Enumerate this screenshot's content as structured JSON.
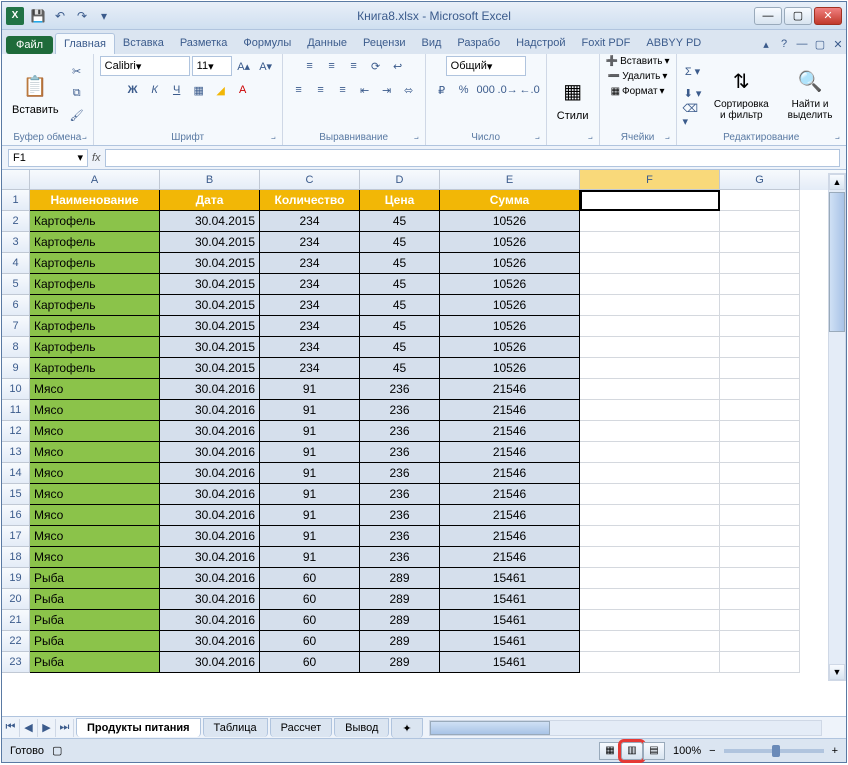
{
  "window": {
    "title": "Книга8.xlsx - Microsoft Excel",
    "app_letter": "X"
  },
  "qat": {
    "save": "💾",
    "undo": "↶",
    "redo": "↷"
  },
  "tabs": {
    "file": "Файл",
    "items": [
      "Главная",
      "Вставка",
      "Разметка",
      "Формулы",
      "Данные",
      "Рецензи",
      "Вид",
      "Разрабо",
      "Надстрой",
      "Foxit PDF",
      "ABBYY PD"
    ],
    "active_index": 0
  },
  "ribbon": {
    "clipboard": {
      "paste": "Вставить",
      "label": "Буфер обмена"
    },
    "font": {
      "name": "Calibri",
      "size": "11",
      "label": "Шрифт",
      "bold": "Ж",
      "italic": "К",
      "underline": "Ч"
    },
    "alignment": {
      "label": "Выравнивание"
    },
    "number": {
      "format": "Общий",
      "label": "Число"
    },
    "styles": {
      "btn": "Стили",
      "label": ""
    },
    "cells": {
      "insert": "Вставить",
      "delete": "Удалить",
      "format": "Формат",
      "label": "Ячейки"
    },
    "editing": {
      "sort": "Сортировка и фильтр",
      "find": "Найти и выделить",
      "label": "Редактирование"
    }
  },
  "formula_bar": {
    "name_box": "F1",
    "fx": "fx",
    "value": ""
  },
  "columns": [
    "A",
    "B",
    "C",
    "D",
    "E",
    "F",
    "G"
  ],
  "selected_cell": "F1",
  "headers": [
    "Наименование",
    "Дата",
    "Количество",
    "Цена",
    "Сумма"
  ],
  "rows": [
    {
      "n": "Картофель",
      "d": "30.04.2015",
      "q": "234",
      "p": "45",
      "s": "10526"
    },
    {
      "n": "Картофель",
      "d": "30.04.2015",
      "q": "234",
      "p": "45",
      "s": "10526"
    },
    {
      "n": "Картофель",
      "d": "30.04.2015",
      "q": "234",
      "p": "45",
      "s": "10526"
    },
    {
      "n": "Картофель",
      "d": "30.04.2015",
      "q": "234",
      "p": "45",
      "s": "10526"
    },
    {
      "n": "Картофель",
      "d": "30.04.2015",
      "q": "234",
      "p": "45",
      "s": "10526"
    },
    {
      "n": "Картофель",
      "d": "30.04.2015",
      "q": "234",
      "p": "45",
      "s": "10526"
    },
    {
      "n": "Картофель",
      "d": "30.04.2015",
      "q": "234",
      "p": "45",
      "s": "10526"
    },
    {
      "n": "Картофель",
      "d": "30.04.2015",
      "q": "234",
      "p": "45",
      "s": "10526"
    },
    {
      "n": "Мясо",
      "d": "30.04.2016",
      "q": "91",
      "p": "236",
      "s": "21546"
    },
    {
      "n": "Мясо",
      "d": "30.04.2016",
      "q": "91",
      "p": "236",
      "s": "21546"
    },
    {
      "n": "Мясо",
      "d": "30.04.2016",
      "q": "91",
      "p": "236",
      "s": "21546"
    },
    {
      "n": "Мясо",
      "d": "30.04.2016",
      "q": "91",
      "p": "236",
      "s": "21546"
    },
    {
      "n": "Мясо",
      "d": "30.04.2016",
      "q": "91",
      "p": "236",
      "s": "21546"
    },
    {
      "n": "Мясо",
      "d": "30.04.2016",
      "q": "91",
      "p": "236",
      "s": "21546"
    },
    {
      "n": "Мясо",
      "d": "30.04.2016",
      "q": "91",
      "p": "236",
      "s": "21546"
    },
    {
      "n": "Мясо",
      "d": "30.04.2016",
      "q": "91",
      "p": "236",
      "s": "21546"
    },
    {
      "n": "Мясо",
      "d": "30.04.2016",
      "q": "91",
      "p": "236",
      "s": "21546"
    },
    {
      "n": "Рыба",
      "d": "30.04.2016",
      "q": "60",
      "p": "289",
      "s": "15461"
    },
    {
      "n": "Рыба",
      "d": "30.04.2016",
      "q": "60",
      "p": "289",
      "s": "15461"
    },
    {
      "n": "Рыба",
      "d": "30.04.2016",
      "q": "60",
      "p": "289",
      "s": "15461"
    },
    {
      "n": "Рыба",
      "d": "30.04.2016",
      "q": "60",
      "p": "289",
      "s": "15461"
    },
    {
      "n": "Рыба",
      "d": "30.04.2016",
      "q": "60",
      "p": "289",
      "s": "15461"
    }
  ],
  "sheets": {
    "active": "Продукты питания",
    "others": [
      "Таблица",
      "Рассчет",
      "Вывод"
    ]
  },
  "status": {
    "ready": "Готово",
    "zoom": "100%"
  }
}
